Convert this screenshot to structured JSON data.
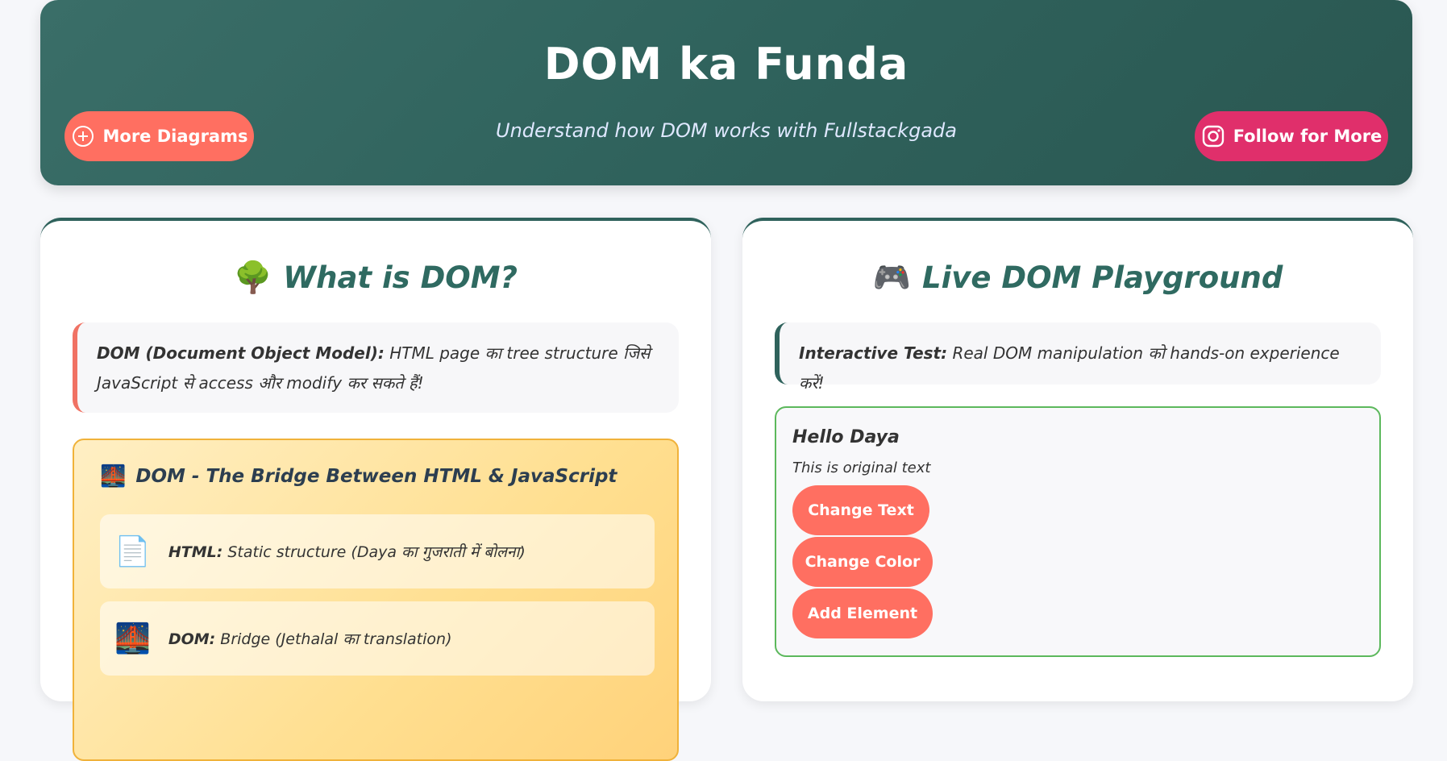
{
  "header": {
    "title": "DOM ka Funda",
    "subtitle": "Understand how DOM works with Fullstackgada",
    "more_button": "More Diagrams",
    "follow_button": "Follow for More"
  },
  "left_card": {
    "icon": "🌳",
    "title": "What is DOM?",
    "info_bold": "DOM (Document Object Model):",
    "info_text": " HTML page का tree structure जिसे JavaScript से access और modify कर सकते हैं!",
    "bridge": {
      "icon": "🌉",
      "title": "DOM - The Bridge Between HTML & JavaScript",
      "items": [
        {
          "icon": "📄",
          "label": "HTML:",
          "text": " Static structure (Daya का गुजराती में बोलना)"
        },
        {
          "icon": "🌉",
          "label": "DOM:",
          "text": " Bridge (Jethalal का translation)"
        }
      ]
    }
  },
  "right_card": {
    "icon": "🎮",
    "title": "Live DOM Playground",
    "info_bold": "Interactive Test:",
    "info_text": " Real DOM manipulation को hands-on experience करें!",
    "playground": {
      "heading": "Hello Daya",
      "text": "This is original text",
      "buttons": [
        "Change Text",
        "Change Color",
        "Add Element"
      ]
    }
  },
  "colors": {
    "header_bg": "#2f625c",
    "more_button": "#ff6f61",
    "follow_button": "#e02f6b",
    "accent_title": "#2f6a61",
    "playground_border": "#5cb85c"
  }
}
